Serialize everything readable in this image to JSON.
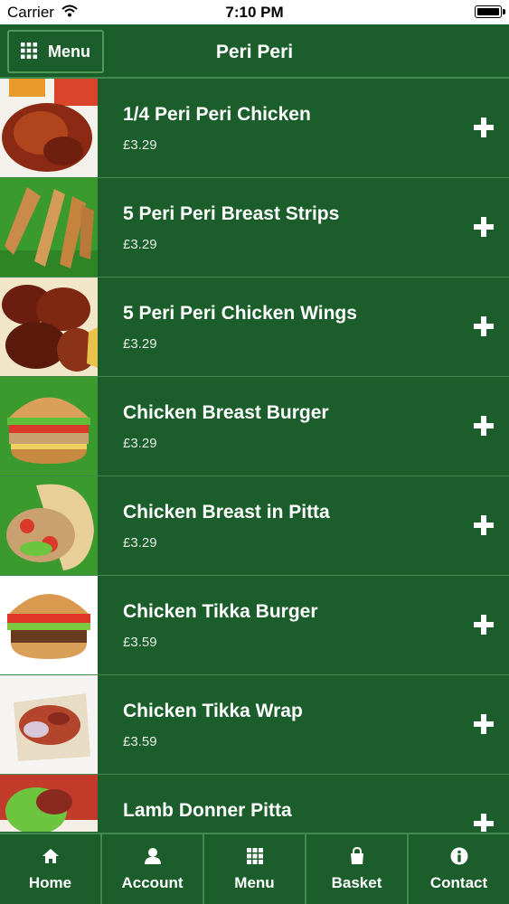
{
  "status_bar": {
    "carrier": "Carrier",
    "time": "7:10 PM"
  },
  "header": {
    "menu_label": "Menu",
    "title": "Peri Peri"
  },
  "items": [
    {
      "name": "1/4 Peri Peri Chicken",
      "price": "£3.29",
      "image": "roast-chicken"
    },
    {
      "name": "5 Peri Peri Breast Strips",
      "price": "£3.29",
      "image": "breast-strips"
    },
    {
      "name": "5 Peri Peri Chicken Wings",
      "price": "£3.29",
      "image": "chicken-wings"
    },
    {
      "name": "Chicken Breast Burger",
      "price": "£3.29",
      "image": "burger"
    },
    {
      "name": "Chicken Breast in Pitta",
      "price": "£3.29",
      "image": "pitta"
    },
    {
      "name": "Chicken Tikka Burger",
      "price": "£3.59",
      "image": "burger"
    },
    {
      "name": "Chicken Tikka Wrap",
      "price": "£3.59",
      "image": "wrap"
    },
    {
      "name": "Lamb Donner Pitta",
      "price": "",
      "image": "pitta"
    }
  ],
  "tabs": [
    {
      "label": "Home",
      "icon": "home-icon"
    },
    {
      "label": "Account",
      "icon": "account-icon"
    },
    {
      "label": "Menu",
      "icon": "grid-icon"
    },
    {
      "label": "Basket",
      "icon": "basket-icon"
    },
    {
      "label": "Contact",
      "icon": "info-icon"
    }
  ],
  "colors": {
    "background": "#1b5e2b",
    "divider": "#3f8a4c",
    "text": "#ffffff"
  }
}
